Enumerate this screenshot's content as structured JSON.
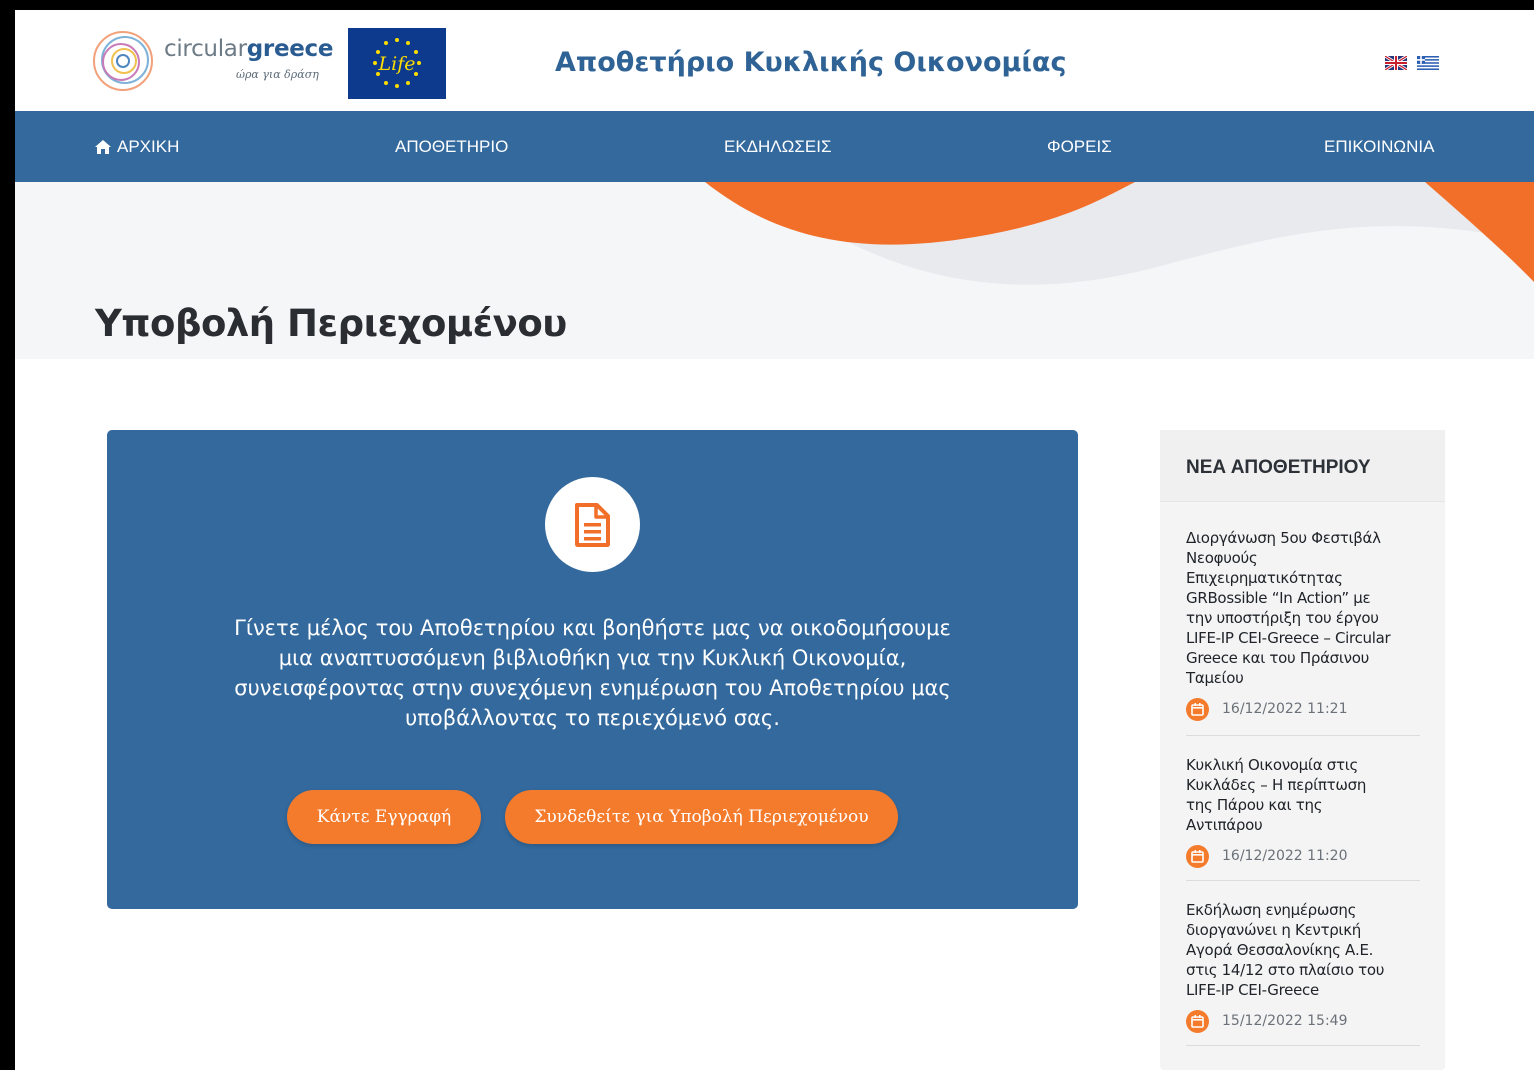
{
  "header": {
    "logo_word_light": "circular",
    "logo_word_bold": "greece",
    "logo_tagline": "ώρα για δράση",
    "life_logo_text": "Life",
    "site_title": "Αποθετήριο Κυκλικής Οικονομίας",
    "languages": [
      "English",
      "Ελληνικά"
    ]
  },
  "nav": {
    "items": [
      {
        "label": "ΑΡΧΙΚΗ"
      },
      {
        "label": "ΑΠΟΘΕΤΗΡΙΟ"
      },
      {
        "label": "ΕΚΔΗΛΩΣΕΙΣ"
      },
      {
        "label": "ΦΟΡΕΙΣ"
      },
      {
        "label": "ΕΠΙΚΟΙΝΩΝΙΑ"
      }
    ]
  },
  "page": {
    "title": "Υποβολή Περιεχομένου"
  },
  "card": {
    "icon": "document-icon",
    "lines": [
      "Γίνετε μέλος του Αποθετηρίου και βοηθήστε μας να οικοδομήσουμε",
      "μια αναπτυσσόμενη βιβλιοθήκη για την Κυκλική Οικονομία,",
      "συνεισφέροντας στην συνεχόμενη ενημέρωση του Αποθετηρίου μας",
      "υποβάλλοντας το περιεχόμενό σας."
    ],
    "register_label": "Κάντε Εγγραφή",
    "login_label": "Συνδεθείτε για Υποβολή Περιεχομένου"
  },
  "sidebar": {
    "title": "ΝΕΑ ΑΠΟΘΕΤΗΡΙΟΥ",
    "news": [
      {
        "title_lines": [
          "Διοργάνωση 5ου Φεστιβάλ",
          "Νεοφυούς",
          "Επιχειρηματικότητας",
          "GRBossible “In Action” με",
          "την υποστήριξη του έργου",
          "LIFE-IP CEI-Greece – Circular",
          "Greece και του Πράσινου",
          "Ταμείου"
        ],
        "date": "16/12/2022 11:21"
      },
      {
        "title_lines": [
          "Κυκλική Οικονομία στις",
          "Κυκλάδες – Η περίπτωση",
          "της Πάρου και της",
          "Αντιπάρου"
        ],
        "date": "16/12/2022 11:20"
      },
      {
        "title_lines": [
          "Εκδήλωση ενημέρωσης",
          "διοργανώνει η Κεντρική",
          "Αγορά Θεσσαλονίκης Α.Ε.",
          "στις 14/12 στο πλαίσιο του",
          "LIFE-IP CEI-Greece"
        ],
        "date": "15/12/2022 15:49"
      }
    ]
  },
  "colors": {
    "brand_blue": "#33699d",
    "accent_orange": "#f47b2c"
  }
}
